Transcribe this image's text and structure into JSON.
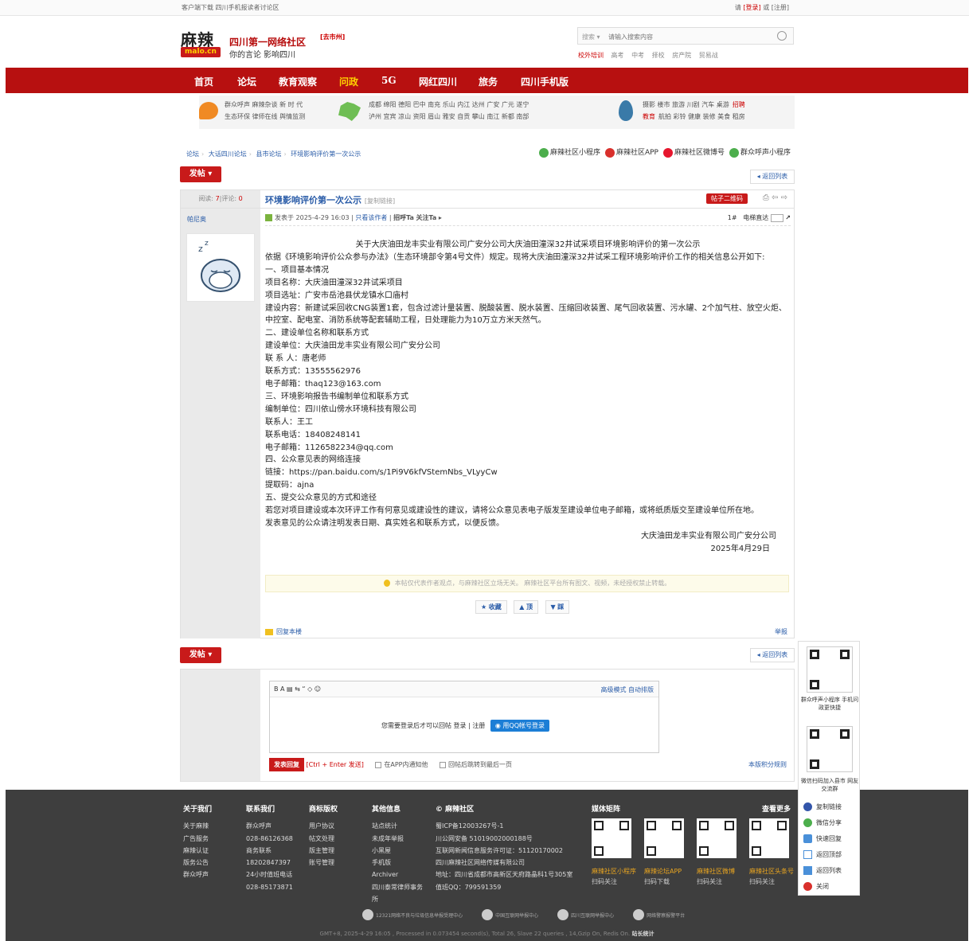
{
  "topbar": {
    "left": "客户端下载  四川手机报读者讨论区",
    "login_pre": "请",
    "login": "[登录]",
    "or": "或",
    "register": "[注册]"
  },
  "header": {
    "logo_cn": "麻辣",
    "logo_en": "malo.cn",
    "site_name": "四川第一网络社区",
    "city": "[去市州]",
    "slogan": "你的言论 影响四川"
  },
  "search": {
    "type": "搜索",
    "placeholder": "请输入搜索内容",
    "links": [
      "校外培训",
      "高考",
      "中考",
      "择校",
      "房产院",
      "贸易战"
    ]
  },
  "nav": [
    "首页",
    "论坛",
    "教育观察",
    "问政",
    "5G",
    "网红四川",
    "旅务",
    "四川手机版"
  ],
  "subnav": {
    "g1r1": "群众呼声 麻辣杂谈 新 时 代",
    "g1r2": "生态环保 律师在线 舆情监测",
    "g2r1": "成都 绵阳 德阳 巴中 南充 乐山 内江 达州 广安 广元 遂宁",
    "g2r2": "泸州 宜宾 凉山 资阳 眉山 雅安 自贡 攀山 南江 新都 南部",
    "g3r1": "摄影 楼市 旅游 川剧 汽车 桌游",
    "g3r1hl": "招聘",
    "g3r2hl": "教育",
    "g3r2": "航拍 彩铃 健康 装修 美食 租房"
  },
  "breadcrumb": [
    "论坛",
    "大话四川论坛",
    "县市论坛",
    "环境影响评价第一次公示"
  ],
  "apps": [
    "麻辣社区小程序",
    "麻辣社区APP",
    "麻辣社区微博号",
    "群众呼声小程序"
  ],
  "post_button": "发帖",
  "back_list": "返回列表",
  "thread": {
    "stats_read": "阅读: ",
    "read": "7",
    "stats_sep": "|评论: ",
    "reply": "0",
    "title": "环境影响评价第一次公示",
    "copy": "[复制链接]",
    "qr": "帖子二维码",
    "author": "帕尼奥",
    "meta_posted": "发表于 2025-4-29 16:03",
    "meta_only": "只看该作者",
    "meta_call": "招呼Ta",
    "meta_follow": "关注Ta",
    "floor": "1#",
    "direct": "电梯直达"
  },
  "content": {
    "title": "关于大庆油田龙丰实业有限公司广安分公司大庆油田潼深32井试采项目环境影响评价的第一次公示",
    "lines": [
      "依据《环境影响评价公众参与办法》（生态环境部令第4号文件）规定。现将大庆油田潼深32井试采工程环境影响评价工作的相关信息公开如下:",
      "一、项目基本情况",
      "项目名称：大庆油田潼深32井试采项目",
      "项目选址：广安市岳池县伏龙镇水口庙村",
      "建设内容：新建试采回收CNG装置1套，包含过滤计量装置、脱酸装置、脱水装置、压缩回收装置、尾气回收装置、污水罐、2个加气柱、放空火炬、中控室、配电室、消防系统等配套辅助工程，日处理能力为10万立方米天然气。",
      "二、建设单位名称和联系方式",
      "建设单位：大庆油田龙丰实业有限公司广安分公司",
      "联 系 人：唐老师",
      "联系方式：13555562976",
      "电子邮箱：thaq123@163.com",
      "三、环境影响报告书编制单位和联系方式",
      "编制单位：四川依山傍水环境科技有限公司",
      "联系人：王工",
      "联系电话：18408248141",
      "电子邮箱：1126582234@qq.com",
      "四、公众意见表的网络连接",
      "链接：https://pan.baidu.com/s/1Pi9V6kfVStemNbs_VLyyCw",
      "提取码：ajna",
      "五、提交公众意见的方式和途径",
      "若您对项目建设或本次环评工作有何意见或建设性的建议，请将公众意见表电子版发至建设单位电子邮箱，或将纸质版交至建设单位所在地。",
      "发表意见的公众请注明发表日期、真实姓名和联系方式，以便反馈。"
    ],
    "sign": "大庆油田龙丰实业有限公司广安分公司",
    "date": "2025年4月29日"
  },
  "notice": "本帖仅代表作者观点，与麻辣社区立场无关。 麻辣社区平台所有图文、视频，未经授权禁止转载。",
  "actions": [
    "收藏",
    "顶",
    "踩"
  ],
  "reply_floor": "回复本楼",
  "report": "举报",
  "editor": {
    "tools": "B  A  ▤  ⇆  “  ◇  ☺",
    "advanced": "高级模式",
    "auto": "自动排版",
    "login_msg": "您需要登录后才可以回帖 登录 | 注册",
    "qq": "用QQ帐号登录",
    "submit": "发表回复",
    "hint": "[Ctrl + Enter 发送]",
    "opt1": "在APP内通知他",
    "opt2": "回帖后跳转到最后一页",
    "rules": "本版积分规则"
  },
  "footer": {
    "c1": {
      "h": "关于我们",
      "items": [
        "关于麻辣",
        "广告服务",
        "麻辣认证",
        "版务公告",
        "群众呼声"
      ]
    },
    "c2": {
      "h": "联系我们",
      "items": [
        "群众呼声",
        "028-86126368",
        "商务联系",
        "18202847397",
        "24小时值班电话",
        "028-85173871"
      ]
    },
    "c3": {
      "h": "商标版权",
      "items": [
        "用户协议",
        "帖文处理",
        "版主管理",
        "账号管理"
      ]
    },
    "c4": {
      "h": "其他信息",
      "items": [
        "站点统计",
        "未成年举报",
        "小黑屋",
        "手机版",
        "Archiver",
        "四川泰常律师事务所"
      ]
    },
    "c5": {
      "h": "© 麻辣社区",
      "items": [
        "蜀ICP备12003267号-1",
        "川公网安备 51019002000188号",
        "互联网新闻信息服务许可证：51120170002",
        "四川麻辣社区网络传媒有限公司",
        "地址：四川省成都市高新区天府路晶科1号305室",
        "值班QQ：799591359"
      ]
    },
    "media": "媒体矩阵",
    "more": "查看更多",
    "qrs": [
      {
        "cap": "麻辣社区小程序",
        "sub": "扫码关注"
      },
      {
        "cap": "麻辣论坛APP",
        "sub": "扫码下载"
      },
      {
        "cap": "麻辣社区微博",
        "sub": "扫码关注"
      },
      {
        "cap": "麻辣社区头条号",
        "sub": "扫码关注"
      }
    ],
    "badges": [
      "12321网络不良与垃圾信息举报受理中心",
      "中国互联网举报中心",
      "四川互联网举报中心",
      "网络警察报警平台"
    ],
    "gmt": "GMT+8, 2025-4-29 16:05 , Processed in 0.073454 second(s), Total 26, Slave 22 queries , 14,Gzip On, Redis On.",
    "stat": "站长统计"
  },
  "float": {
    "qr1": "群众呼声小程序 手机问政更快捷",
    "qr2": "微信扫码加入县市 网友交流群",
    "items": [
      "复制链接",
      "微信分享",
      "快速回复",
      "返回顶部",
      "返回列表",
      "关闭"
    ]
  }
}
